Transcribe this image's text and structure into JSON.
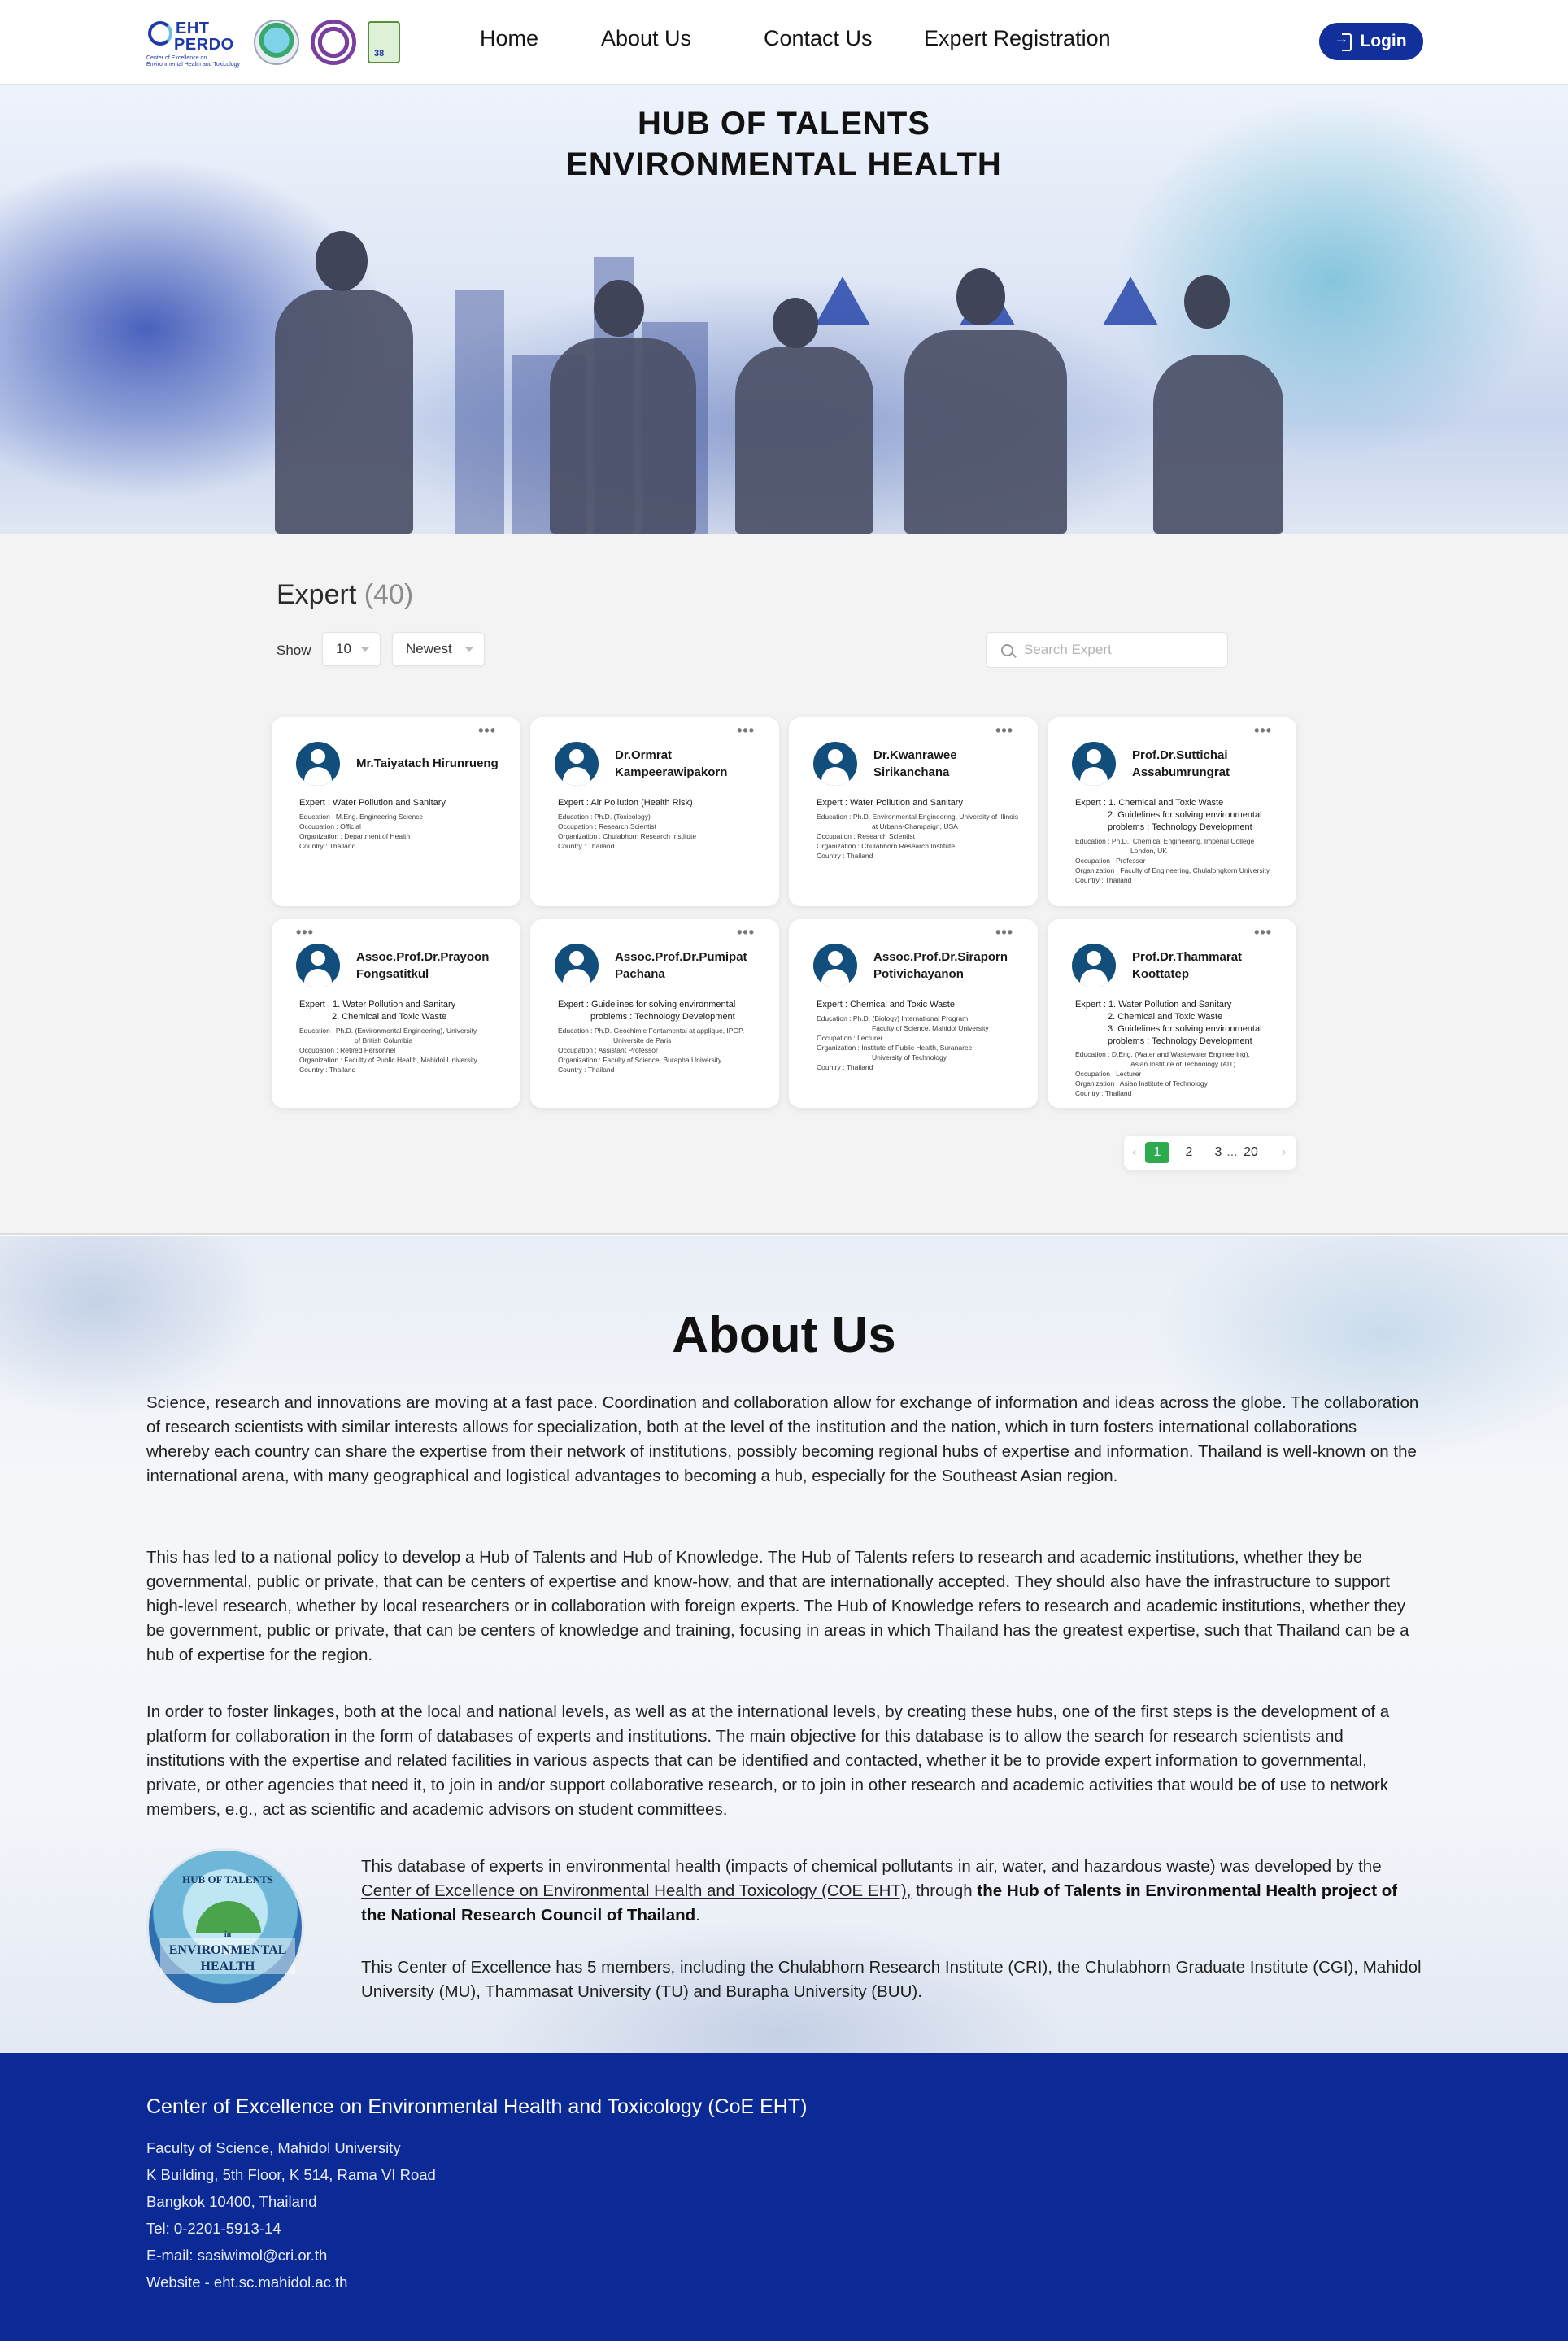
{
  "header": {
    "logos": {
      "eht_line1": "EHT",
      "eht_line2": "PERDO",
      "eht_subtitle": "Center of Excellence on Environmental Health and Toxicology"
    },
    "nav": [
      {
        "label": "Home"
      },
      {
        "label": "About Us"
      },
      {
        "label": "Contact Us"
      },
      {
        "label": "Expert Registration"
      }
    ],
    "login_label": "Login"
  },
  "hero": {
    "title_line1": "HUB OF TALENTS",
    "title_line2": "ENVIRONMENTAL HEALTH"
  },
  "experts": {
    "title": "Expert",
    "count": "(40)",
    "show_label": "Show",
    "page_size": "10",
    "sort": "Newest",
    "search_placeholder": "Search Expert",
    "cards": [
      {
        "name": "Mr.Taiyatach   Hirunrueng",
        "expert_lines": [
          "Expert : Water Pollution and Sanitary"
        ],
        "meta": [
          "Education : M.Eng. Engineering Science",
          "Occupation : Official",
          "Organization : Department of Health",
          "Country : Thailand"
        ]
      },
      {
        "name": "Dr.Ormrat Kampeerawipakorn",
        "expert_lines": [
          "Expert : Air Pollution (Health Risk)"
        ],
        "meta": [
          "Education : Ph.D. (Toxicology)",
          "Occupation : Research Scientist",
          "Organization : Chulabhorn Research Institute",
          "Country : Thailand"
        ]
      },
      {
        "name": "Dr.Kwanrawee Sirikanchana",
        "expert_lines": [
          "Expert : Water Pollution and Sanitary"
        ],
        "meta": [
          "Education : Ph.D. Environmental Engineering, University of Illinois",
          "at Urbana-Champaign, USA",
          "Occupation : Research Scientist",
          "Organization : Chulabhorn Research Institute",
          "Country : Thailand"
        ]
      },
      {
        "name": "Prof.Dr.Suttichai Assabumrungrat",
        "expert_lines": [
          "Expert : 1. Chemical and Toxic Waste",
          "2. Guidelines for solving environmental",
          "problems : Technology Development"
        ],
        "meta": [
          "Education : Ph.D., Chemical Engineering, Imperial College",
          "London, UK",
          "Occupation : Professor",
          "Organization : Faculty of Engineering, Chulalongkorn University",
          "Country : Thailand"
        ]
      },
      {
        "name": "Assoc.Prof.Dr.Prayoon Fongsatitkul",
        "expert_lines": [
          "Expert : 1. Water Pollution and Sanitary",
          "2. Chemical and Toxic Waste"
        ],
        "meta": [
          "Education : Ph.D. (Environmental Engineering), University",
          "of British Columbia",
          "Occupation : Retired Personnel",
          "Organization : Faculty of Public Health, Mahidol University",
          "Country : Thailand"
        ]
      },
      {
        "name": "Assoc.Prof.Dr.Pumipat Pachana",
        "expert_lines": [
          "Expert : Guidelines for solving environmental",
          "problems : Technology Development"
        ],
        "meta": [
          "Education : Ph.D. Geochimie Fontamental at appliqué, IPGP,",
          "Universite de Paris",
          "Occupation : Assistant Professor",
          "Organization : Faculty of Science, Burapha University",
          "Country : Thailand"
        ]
      },
      {
        "name": "Assoc.Prof.Dr.Siraporn Potivichayanon",
        "expert_lines": [
          "Expert : Chemical and Toxic Waste"
        ],
        "meta": [
          "Education : Ph.D. (Biology) International Program,",
          "Faculty of Science, Mahidol University",
          "Occupation : Lecturer",
          "Organization : Institute of Public Health, Suranaree",
          "University of Technology",
          "Country : Thailand"
        ]
      },
      {
        "name": "Prof.Dr.Thammarat Koottatep",
        "expert_lines": [
          "Expert : 1. Water Pollution and Sanitary",
          "2. Chemical and Toxic Waste",
          "3. Guidelines for solving environmental",
          "problems : Technology Development"
        ],
        "meta": [
          "Education : D.Eng. (Water and Wastewater Engineering),",
          "Asian Institute of Technology (AIT)",
          "Occupation : Lecturer",
          "Organization : Asian Institute of Technology",
          "Country : Thailand"
        ]
      }
    ],
    "pagination": {
      "prev": "‹",
      "pages": [
        "1",
        "2",
        "3"
      ],
      "ellipsis": "...",
      "last": "20",
      "next": "›"
    }
  },
  "about": {
    "title": "About Us",
    "p1": "Science, research and innovations are moving at a fast pace. Coordination and collaboration allow for exchange of information and ideas across the globe. The collaboration of research scientists with similar interests allows for specialization, both at the level of the institution and the nation, which in turn fosters international collaborations whereby each country can share the expertise from their network of institutions, possibly becoming regional hubs of expertise and information. Thailand is well-known on the international arena, with many geographical and logistical advantages to becoming a hub, especially for the Southeast Asian region.",
    "p2": "This has led to a national policy to develop a Hub of Talents and Hub of Knowledge. The Hub of Talents refers to research and academic institutions, whether they be governmental, public or private, that can be centers of expertise and know-how, and that are internationally accepted. They should also have the infrastructure to support high-level research, whether by local researchers or in collaboration with foreign experts. The Hub of Knowledge refers to research and academic institutions, whether they be government, public or private, that can be centers of knowledge and training, focusing in areas in which Thailand has the greatest expertise, such that Thailand can be a hub of expertise for the region.",
    "p3": "In order to foster linkages, both at the local and national levels, as well as at the international levels, by creating these hubs, one of the first steps is the development of a platform for collaboration in the form of databases of experts and institutions. The main objective for this database is to allow the search for research scientists and institutions with the expertise and related facilities in various aspects that can be identified and contacted, whether it be to provide expert information to governmental, private, or other agencies that need it, to join in and/or support collaborative research, or to join in other research and academic activities that would be of use to network members, e.g., act as scientific and academic advisors on student committees.",
    "p4_before": "This database of experts in environmental health (impacts of chemical pollutants in air, water, and hazardous waste) was developed by the ",
    "p4_link": "Center of Excellence on Environmental Health and Toxicology (COE EHT),",
    "p4_mid": " through ",
    "p4_bold": "the Hub of Talents in Environmental Health project of the National Research Council of Thailand",
    "p4_end": ".",
    "p5": "This Center of Excellence has 5 members, including the Chulabhorn Research Institute (CRI), the Chulabhorn Graduate Institute (CGI), Mahidol University (MU), Thammasat University (TU) and Burapha University (BUU).",
    "logo_top": "HUB OF TALENTS",
    "logo_in": "in",
    "logo_mid": "ENVIRONMENTAL",
    "logo_bot": "HEALTH"
  },
  "footer": {
    "title": "Center of Excellence on Environmental Health and Toxicology (CoE EHT)",
    "lines": [
      "Faculty of Science, Mahidol University",
      "K Building, 5th Floor, K 514, Rama VI Road",
      "Bangkok 10400, Thailand",
      "Tel: 0-2201-5913-14",
      "E-mail: sasiwimol@cri.or.th",
      "Website - eht.sc.mahidol.ac.th"
    ]
  },
  "colors": {
    "brand_blue": "#12309c",
    "footer_blue": "#0b2a96",
    "avatar_blue": "#124e7b",
    "pager_active": "#2eaa4f"
  }
}
